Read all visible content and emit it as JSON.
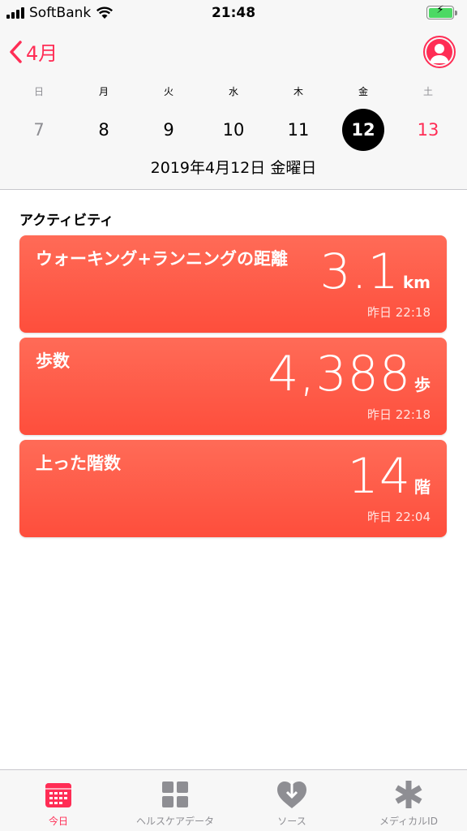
{
  "status_bar": {
    "carrier": "SoftBank",
    "time": "21:48"
  },
  "header": {
    "back_label": "4月",
    "week": [
      {
        "dow": "日",
        "day": "7",
        "color": "#8e8e93",
        "dow_color": "#8e8e93",
        "selected": false
      },
      {
        "dow": "月",
        "day": "8",
        "color": "#000000",
        "dow_color": "#000000",
        "selected": false
      },
      {
        "dow": "火",
        "day": "9",
        "color": "#000000",
        "dow_color": "#000000",
        "selected": false
      },
      {
        "dow": "水",
        "day": "10",
        "color": "#000000",
        "dow_color": "#000000",
        "selected": false
      },
      {
        "dow": "木",
        "day": "11",
        "color": "#000000",
        "dow_color": "#000000",
        "selected": false
      },
      {
        "dow": "金",
        "day": "12",
        "color": "#ffffff",
        "dow_color": "#000000",
        "selected": true
      },
      {
        "dow": "土",
        "day": "13",
        "color": "#ff2d55",
        "dow_color": "#8e8e93",
        "selected": false
      }
    ],
    "full_date": "2019年4月12日 金曜日"
  },
  "section_title": "アクティビティ",
  "cards": [
    {
      "title": "ウォーキング+ランニングの距離",
      "value": "3.1",
      "unit": "km",
      "time": "昨日 22:18"
    },
    {
      "title": "歩数",
      "value": "4,388",
      "unit": "歩",
      "time": "昨日 22:18"
    },
    {
      "title": "上った階数",
      "value": "14",
      "unit": "階",
      "time": "昨日 22:04"
    }
  ],
  "tabs": [
    {
      "label": "今日",
      "icon": "calendar-icon",
      "active": true
    },
    {
      "label": "ヘルスケアデータ",
      "icon": "grid-icon",
      "active": false
    },
    {
      "label": "ソース",
      "icon": "heart-download-icon",
      "active": false
    },
    {
      "label": "メディカルID",
      "icon": "asterisk-icon",
      "active": false
    }
  ],
  "colors": {
    "accent": "#ff2d55",
    "card": "#fe5a46",
    "inactive": "#8e8e93"
  }
}
